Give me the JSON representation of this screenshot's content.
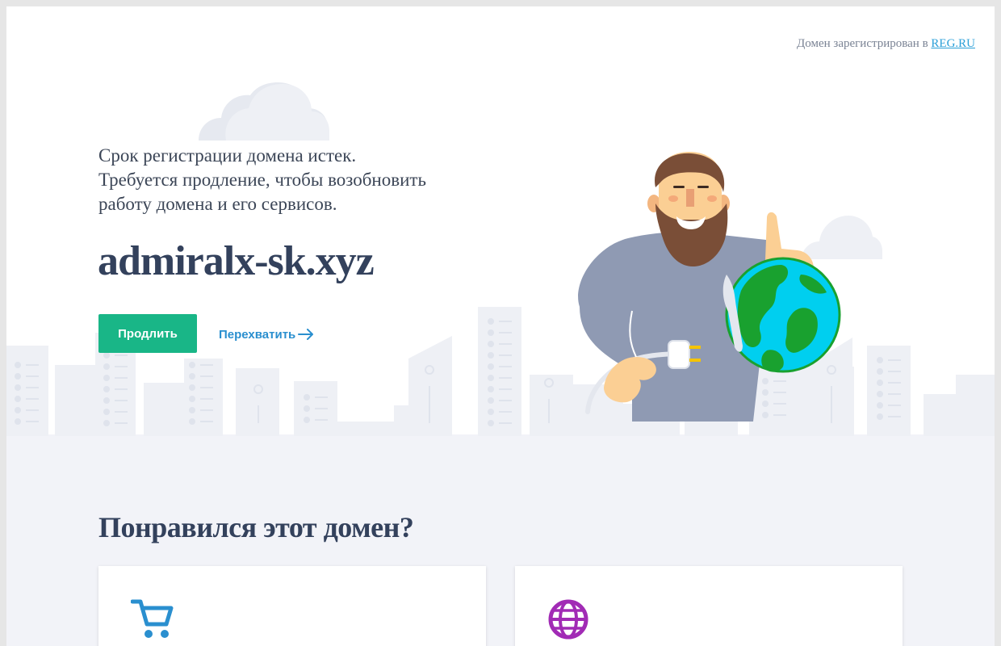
{
  "registrar": {
    "text": "Домен зарегистрирован в",
    "link": "REG.RU"
  },
  "message": {
    "line1": "Срок регистрации домена истек.",
    "line2": "Требуется продление, чтобы возобновить",
    "line3": "работу домена и его сервисов."
  },
  "domain_name": "admiralx-sk.xyz",
  "actions": {
    "renew_label": "Продлить",
    "intercept_label": "Перехватить"
  },
  "section": {
    "title": "Понравился этот домен?"
  },
  "cards": [
    {
      "icon": "cart-icon",
      "color": "#2a8fcf"
    },
    {
      "icon": "globe-icon",
      "color": "#a12bb5"
    }
  ],
  "colors": {
    "primary_button": "#19b687",
    "link": "#2a8fcf",
    "heading": "#33415c",
    "page_bg": "#f2f3f8"
  }
}
